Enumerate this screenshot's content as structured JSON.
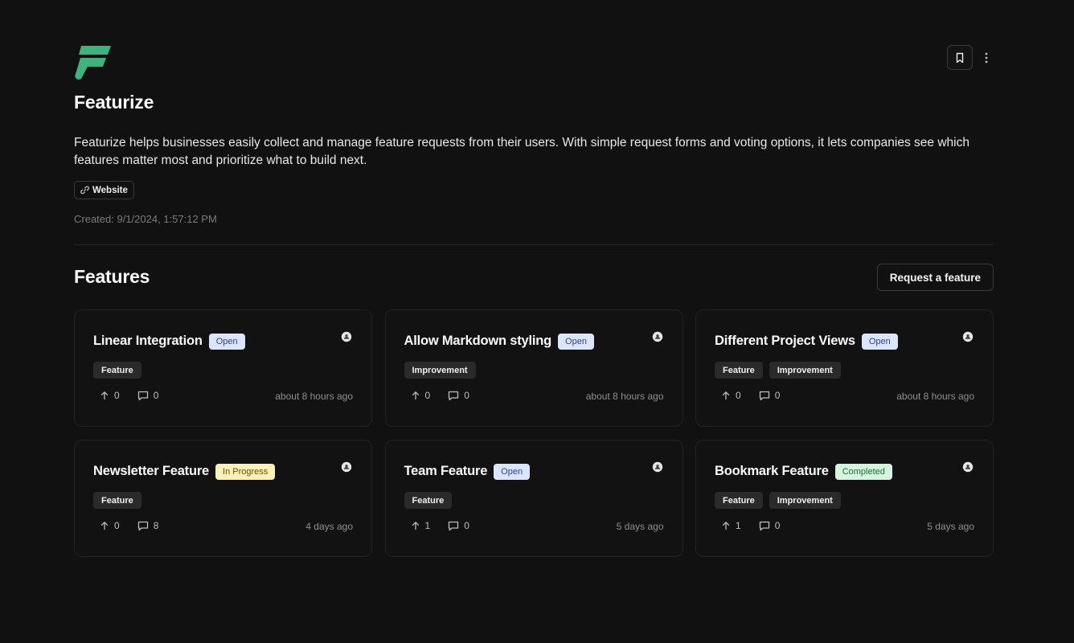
{
  "app": {
    "name": "Featurize",
    "description": "Featurize helps businesses easily collect and manage feature requests from their users. With simple request forms and voting options, it lets companies see which features matter most and prioritize what to build next.",
    "website_label": "Website",
    "created": "Created: 9/1/2024, 1:57:12 PM",
    "logo_color": "#3fb27f"
  },
  "icons": {
    "logo": "featurize-logo-icon",
    "bookmark": "bookmark-icon",
    "more": "more-vertical-icon",
    "link": "link-icon",
    "upvote": "arrow-up-icon",
    "comments": "comment-icon",
    "avatar": "user-avatar-icon"
  },
  "features_section": {
    "title": "Features",
    "request_button": "Request a feature"
  },
  "colors": {
    "background": "#111111",
    "status_open_bg": "#dbe5ff",
    "status_in_progress_bg": "#fdf0b8",
    "status_completed_bg": "#d6f5df"
  },
  "features": [
    {
      "title": "Linear Integration",
      "status": "Open",
      "status_key": "open",
      "tags": [
        "Feature"
      ],
      "votes": "0",
      "comments": "0",
      "time": "about 8 hours ago"
    },
    {
      "title": "Allow Markdown styling",
      "status": "Open",
      "status_key": "open",
      "tags": [
        "Improvement"
      ],
      "votes": "0",
      "comments": "0",
      "time": "about 8 hours ago"
    },
    {
      "title": "Different Project Views",
      "status": "Open",
      "status_key": "open",
      "tags": [
        "Feature",
        "Improvement"
      ],
      "votes": "0",
      "comments": "0",
      "time": "about 8 hours ago"
    },
    {
      "title": "Newsletter Feature",
      "status": "In Progress",
      "status_key": "progress",
      "tags": [
        "Feature"
      ],
      "votes": "0",
      "comments": "8",
      "time": "4 days ago"
    },
    {
      "title": "Team Feature",
      "status": "Open",
      "status_key": "open",
      "tags": [
        "Feature"
      ],
      "votes": "1",
      "comments": "0",
      "time": "5 days ago"
    },
    {
      "title": "Bookmark Feature",
      "status": "Completed",
      "status_key": "completed",
      "tags": [
        "Feature",
        "Improvement"
      ],
      "votes": "1",
      "comments": "0",
      "time": "5 days ago"
    }
  ]
}
